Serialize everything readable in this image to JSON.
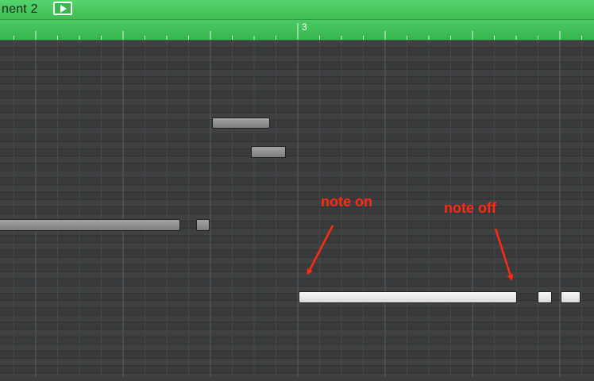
{
  "header": {
    "region_title": "nent 2",
    "play_icon": "play-icon",
    "color": "#45c75c"
  },
  "ruler": {
    "bar_label": "3"
  },
  "grid": {
    "background": "#3b3d3e"
  },
  "annotations": {
    "note_on": "note on",
    "note_off": "note off",
    "color": "#ff2a10"
  }
}
